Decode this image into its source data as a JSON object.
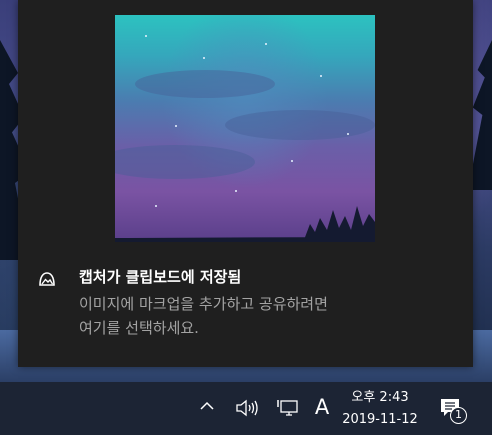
{
  "notification": {
    "title": "캡처가 클립보드에 저장됨",
    "body_line1": "이미지에 마크업을 추가하고 공유하려면",
    "body_line2": "여기를 선택하세요.",
    "app_icon": "snip-sketch-icon",
    "preview_image": "aurora-night-sky-thumbnail"
  },
  "taskbar": {
    "tray_icons": [
      "chevron-up-icon",
      "speaker-icon",
      "network-icon",
      "ime-icon"
    ],
    "ime_label": "A",
    "clock": {
      "time": "오후 2:43",
      "date": "2019-11-12"
    },
    "action_center": {
      "icon": "action-center-icon",
      "badge_count": "1"
    }
  },
  "colors": {
    "toast_bg": "#1f1f1f",
    "taskbar_bg": "#1c2434",
    "title_text": "#ffffff",
    "body_text": "#a3a3a3"
  }
}
